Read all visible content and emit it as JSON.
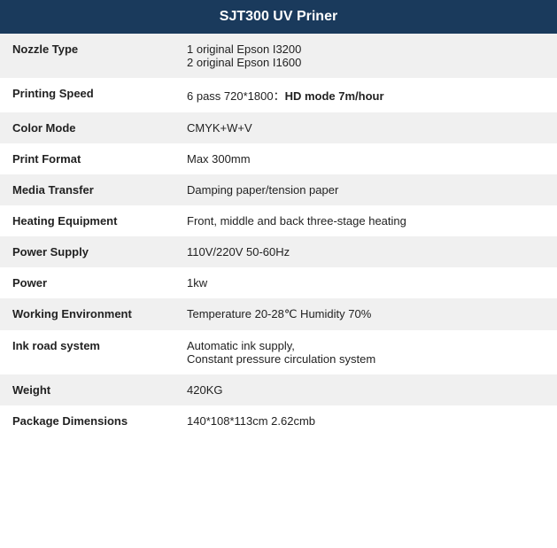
{
  "header": {
    "title": "SJT300 UV Priner"
  },
  "rows": [
    {
      "label": "Nozzle Type",
      "value": "1 original Epson I3200\n2 original Epson I1600",
      "bold_part": null
    },
    {
      "label": "Printing Speed",
      "value_prefix": "6 pass 720*1800：",
      "value_bold": "HD mode 7m/hour",
      "value": null,
      "is_mixed": true
    },
    {
      "label": "Color Mode",
      "value": "CMYK+W+V",
      "bold_part": null
    },
    {
      "label": "Print Format",
      "value": "Max 300mm",
      "bold_part": null
    },
    {
      "label": "Media Transfer",
      "value": "Damping paper/tension paper",
      "bold_part": null
    },
    {
      "label": "Heating Equipment",
      "value": "Front, middle and back three-stage heating",
      "bold_part": null
    },
    {
      "label": "Power Supply",
      "value": "110V/220V 50-60Hz",
      "bold_part": null
    },
    {
      "label": "Power",
      "value": "1kw",
      "bold_part": null
    },
    {
      "label": "Working Environment",
      "value": "Temperature 20-28℃ Humidity 70%",
      "bold_part": null
    },
    {
      "label": "Ink road system",
      "value": "Automatic ink supply,\nConstant pressure circulation system",
      "bold_part": null
    },
    {
      "label": "Weight",
      "value": "420KG",
      "bold_part": null
    },
    {
      "label": "Package Dimensions",
      "value": "140*108*113cm 2.62cmb",
      "bold_part": null
    }
  ]
}
